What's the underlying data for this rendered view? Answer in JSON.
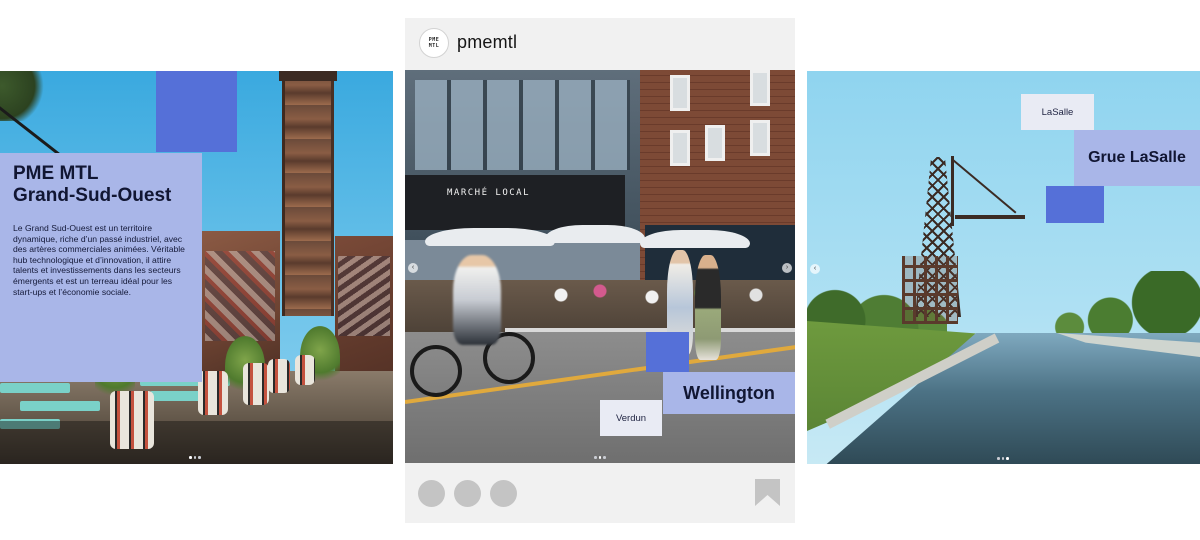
{
  "colors": {
    "accent_blue": "#5570d8",
    "lavender": "#a9b6e8",
    "pale_label": "#e9ebf4",
    "text_dark": "#111633",
    "instagram_bg": "#f1f1f1",
    "ui_gray": "#c4c4c4"
  },
  "slide_left": {
    "title": "PME MTL\nGrand-Sud-Ouest",
    "body": "Le Grand Sud-Ouest est un territoire dynamique, riche d’un passé industriel, avec des artères commerciales animées. Véritable hub technologique et d’innovation, il attire talents et investissements dans les secteurs émergents et est un terreau idéal pour les start-ups et l’économie sociale."
  },
  "post": {
    "avatar_logo_text": "PME\nMTL",
    "username": "pmemtl",
    "photo_sign_text": "MARCHÉ LOCAL",
    "label_big": "Wellington",
    "label_small": "Verdun",
    "icons": {
      "action_1": "like-icon",
      "action_2": "comment-icon",
      "action_3": "share-icon",
      "save": "bookmark-icon"
    }
  },
  "slide_right": {
    "label_small": "LaSalle",
    "label_big": "Grue LaSalle"
  }
}
